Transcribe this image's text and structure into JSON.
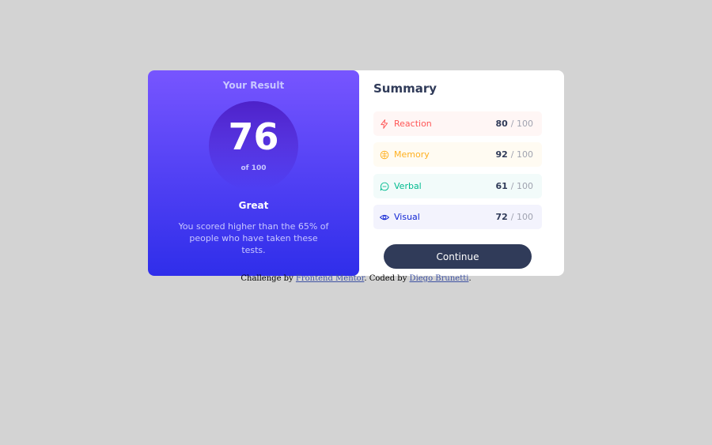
{
  "result": {
    "title": "Your Result",
    "score": "76",
    "of_label": "of 100",
    "rating": "Great",
    "description": "You scored higher than the 65% of people who have taken these tests."
  },
  "summary": {
    "title": "Summary",
    "items": [
      {
        "label": "Reaction",
        "score": "80",
        "outof": "/ 100",
        "icon": "lightning-icon",
        "color": "#ff5757"
      },
      {
        "label": "Memory",
        "score": "92",
        "outof": "/ 100",
        "icon": "brain-icon",
        "color": "#ffb01f"
      },
      {
        "label": "Verbal",
        "score": "61",
        "outof": "/ 100",
        "icon": "chat-bubble-icon",
        "color": "#00bb8f"
      },
      {
        "label": "Visual",
        "score": "72",
        "outof": "/ 100",
        "icon": "eye-icon",
        "color": "#1125d4"
      }
    ],
    "button_label": "Continue"
  },
  "attribution": {
    "prefix": "Challenge by ",
    "link1": "Frontend Mentor",
    "middle": ". Coded by ",
    "link2": "Diego Brunetti",
    "suffix": "."
  },
  "colors": {
    "background": "#d3d3d3",
    "gradient_start": "#7755ff",
    "gradient_end": "#2f2eea",
    "button": "#303b59"
  }
}
